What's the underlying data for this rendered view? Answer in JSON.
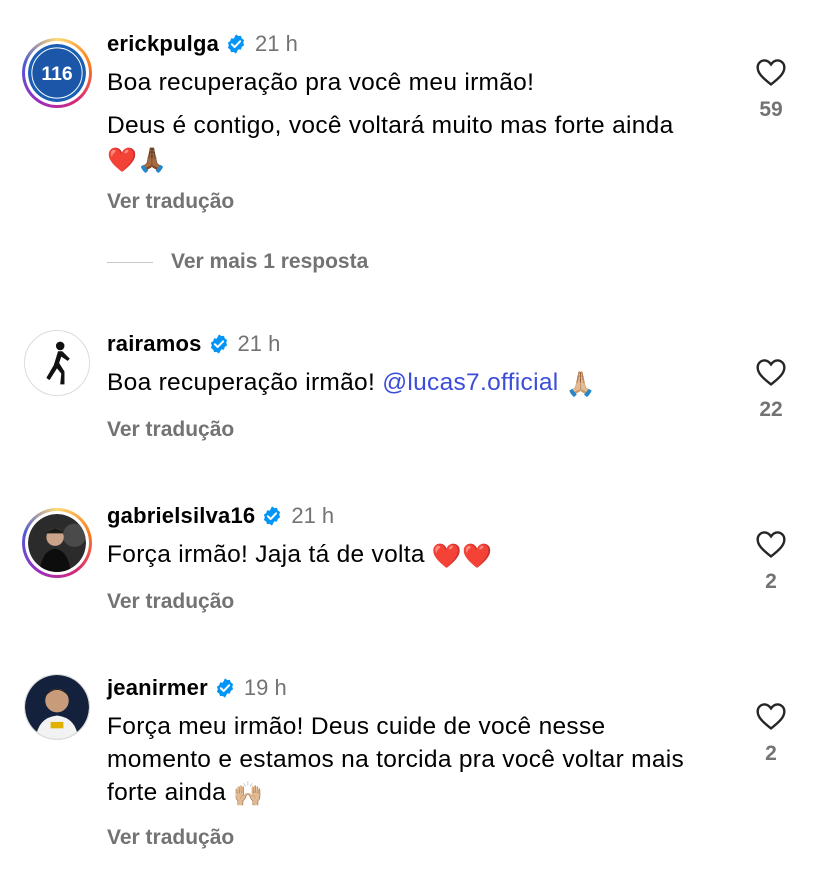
{
  "comments": [
    {
      "username": "erickpulga",
      "time": "21 h",
      "text_lines": [
        "Boa recuperação pra você meu irmão!",
        "Deus é contigo, você voltará muito mas forte ainda"
      ],
      "emoji_tail": "❤️🙏🏾",
      "translate_label": "Ver tradução",
      "likes": "59",
      "avatar_text": "116"
    },
    {
      "username": "rairamos",
      "time": "21 h",
      "text_before": "Boa recuperação irmão!",
      "mention": "@lucas7.official",
      "emoji_tail": "🙏🏼",
      "translate_label": "Ver tradução",
      "likes": "22"
    },
    {
      "username": "gabrielsilva16",
      "time": "21 h",
      "text": "Força irmão! Jaja tá de volta",
      "emoji_tail": "❤️❤️",
      "translate_label": "Ver tradução",
      "likes": "2"
    },
    {
      "username": "jeanirmer",
      "time": "19 h",
      "text": "Força meu irmão! Deus cuide de você nesse momento e estamos na torcida pra você voltar mais forte ainda",
      "emoji_tail": "🙌🏼",
      "translate_label": "Ver tradução",
      "likes": "2"
    }
  ],
  "replies_label": "Ver mais 1 resposta",
  "colors": {
    "verified": "#0095f6",
    "muted": "#737373",
    "mention": "#3b4dd9",
    "heart_stroke": "#262626"
  },
  "icons": {
    "verified": "verified-badge-icon",
    "like": "heart-outline-icon"
  }
}
